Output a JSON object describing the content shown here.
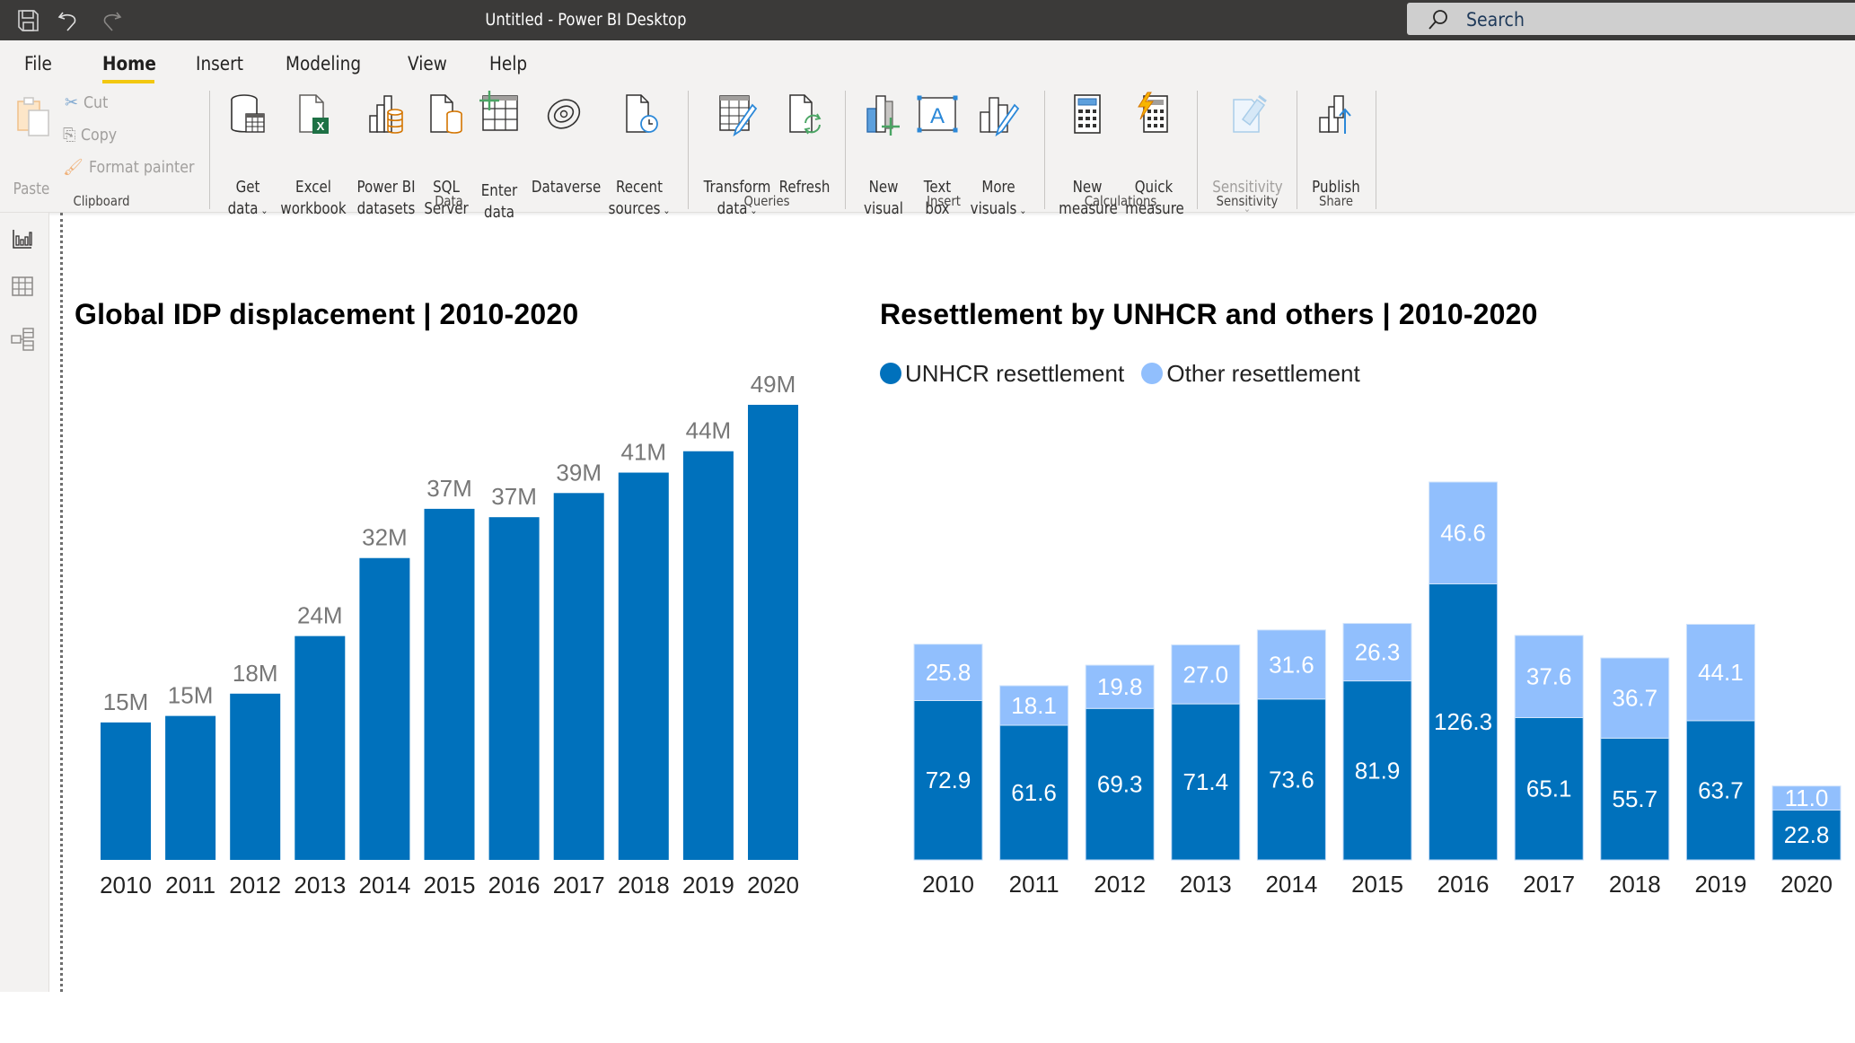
{
  "window": {
    "title": "Untitled - Power BI Desktop",
    "search_placeholder": "Search",
    "quick_access": [
      "save-icon",
      "undo-icon",
      "redo-icon"
    ]
  },
  "tabs": [
    {
      "label": "File",
      "active": false
    },
    {
      "label": "Home",
      "active": true
    },
    {
      "label": "Insert",
      "active": false
    },
    {
      "label": "Modeling",
      "active": false
    },
    {
      "label": "View",
      "active": false
    },
    {
      "label": "Help",
      "active": false
    }
  ],
  "ribbon": {
    "clipboard": {
      "group_label": "Clipboard",
      "paste": "Paste",
      "cut": "Cut",
      "copy": "Copy",
      "format_painter": "Format painter"
    },
    "data": {
      "group_label": "Data",
      "get_data": [
        "Get",
        "data"
      ],
      "excel": [
        "Excel",
        "workbook"
      ],
      "pbi_datasets": [
        "Power BI",
        "datasets"
      ],
      "sql": [
        "SQL",
        "Server"
      ],
      "enter_data": [
        "Enter",
        "data"
      ],
      "dataverse": [
        "Dataverse",
        ""
      ],
      "recent_sources": [
        "Recent",
        "sources"
      ]
    },
    "queries": {
      "group_label": "Queries",
      "transform": [
        "Transform",
        "data"
      ],
      "refresh": [
        "Refresh",
        ""
      ]
    },
    "insert": {
      "group_label": "Insert",
      "new_visual": [
        "New",
        "visual"
      ],
      "text_box": [
        "Text",
        "box"
      ],
      "more_visuals": [
        "More",
        "visuals"
      ]
    },
    "calculations": {
      "group_label": "Calculations",
      "new_measure": [
        "New",
        "measure"
      ],
      "quick_measure": [
        "Quick",
        "measure"
      ]
    },
    "sensitivity": {
      "group_label": "Sensitivity",
      "sensitivity": [
        "Sensitivity",
        ""
      ]
    },
    "share": {
      "group_label": "Share",
      "publish": [
        "Publish",
        ""
      ]
    }
  },
  "sidebar": {
    "items": [
      {
        "name": "report-view",
        "icon": "bar-chart-icon"
      },
      {
        "name": "data-view",
        "icon": "table-icon"
      },
      {
        "name": "model-view",
        "icon": "model-icon"
      }
    ]
  },
  "colors": {
    "primary_bar": "#0071bc",
    "secondary_bar": "#91bffd",
    "data_label_outside": "#777777",
    "data_label_inside": "#ffffff",
    "accent_tab": "#f2c811"
  },
  "chart_data": [
    {
      "type": "bar",
      "title": "Global IDP displacement | 2010-2020",
      "xlabel": "",
      "ylabel": "",
      "categories": [
        "2010",
        "2011",
        "2012",
        "2013",
        "2014",
        "2015",
        "2016",
        "2017",
        "2018",
        "2019",
        "2020"
      ],
      "values": [
        14.8,
        15.5,
        17.9,
        24.1,
        32.5,
        37.8,
        36.9,
        39.5,
        41.7,
        44.0,
        49.0
      ],
      "data_labels": [
        "15M",
        "15M",
        "18M",
        "24M",
        "32M",
        "37M",
        "37M",
        "39M",
        "41M",
        "44M",
        "49M"
      ],
      "units": "millions",
      "ylim": [
        0,
        49
      ],
      "grid": false,
      "legend": "none"
    },
    {
      "type": "bar",
      "stacked": true,
      "title": "Resettlement by UNHCR and others | 2010-2020",
      "xlabel": "",
      "ylabel": "",
      "categories": [
        "2010",
        "2011",
        "2012",
        "2013",
        "2014",
        "2015",
        "2016",
        "2017",
        "2018",
        "2019",
        "2020"
      ],
      "series": [
        {
          "name": "UNHCR resettlement",
          "values": [
            72.9,
            61.6,
            69.3,
            71.4,
            73.6,
            81.9,
            126.3,
            65.1,
            55.7,
            63.7,
            22.8
          ]
        },
        {
          "name": "Other resettlement",
          "values": [
            25.8,
            18.1,
            19.8,
            27.0,
            31.6,
            26.3,
            46.6,
            37.6,
            36.7,
            44.1,
            11.0
          ]
        }
      ],
      "ylim": [
        0,
        172.9
      ],
      "grid": false,
      "legend": "top-left"
    }
  ]
}
